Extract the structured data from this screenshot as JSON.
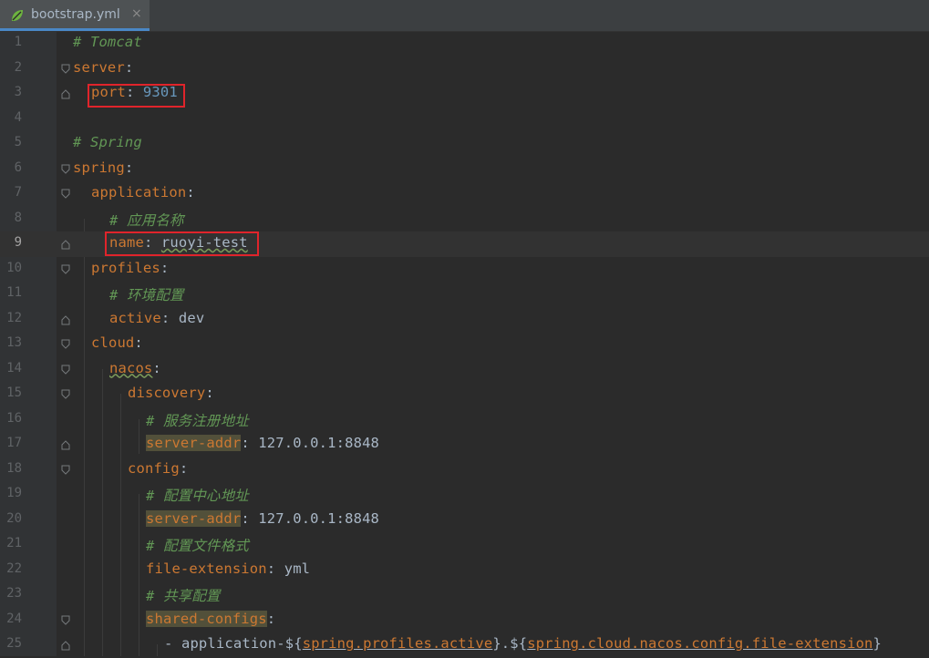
{
  "tab": {
    "label": "bootstrap.yml",
    "close": "×",
    "icon": "spring-leaf-icon"
  },
  "colors": {
    "keyword": "#cc7832",
    "comment": "#629755",
    "number": "#6897bb",
    "text": "#a9b7c6",
    "highlight_box": "#e0242b"
  },
  "lines": [
    {
      "num": "1",
      "indent": 0,
      "comment": "# Tomcat"
    },
    {
      "num": "2",
      "indent": 0,
      "key": "server",
      "sep": ":"
    },
    {
      "num": "3",
      "indent": 1,
      "key": "port",
      "sep": ": ",
      "number": "9301"
    },
    {
      "num": "4",
      "indent": 0
    },
    {
      "num": "5",
      "indent": 0,
      "comment": "# Spring"
    },
    {
      "num": "6",
      "indent": 0,
      "key": "spring",
      "sep": ":"
    },
    {
      "num": "7",
      "indent": 1,
      "key": "application",
      "sep": ":"
    },
    {
      "num": "8",
      "indent": 2,
      "comment": "# 应用名称"
    },
    {
      "num": "9",
      "indent": 2,
      "key": "name",
      "sep": ": ",
      "value": "ruoyi-test"
    },
    {
      "num": "10",
      "indent": 1,
      "key": "profiles",
      "sep": ":"
    },
    {
      "num": "11",
      "indent": 2,
      "comment": "# 环境配置"
    },
    {
      "num": "12",
      "indent": 2,
      "key": "active",
      "sep": ": ",
      "value": "dev"
    },
    {
      "num": "13",
      "indent": 1,
      "key": "cloud",
      "sep": ":"
    },
    {
      "num": "14",
      "indent": 2,
      "key": "nacos",
      "sep": ":"
    },
    {
      "num": "15",
      "indent": 3,
      "key": "discovery",
      "sep": ":"
    },
    {
      "num": "16",
      "indent": 4,
      "comment": "# 服务注册地址"
    },
    {
      "num": "17",
      "indent": 4,
      "key": "server-addr",
      "sep": ": ",
      "value": "127.0.0.1:8848"
    },
    {
      "num": "18",
      "indent": 3,
      "key": "config",
      "sep": ":"
    },
    {
      "num": "19",
      "indent": 4,
      "comment": "# 配置中心地址"
    },
    {
      "num": "20",
      "indent": 4,
      "key": "server-addr",
      "sep": ": ",
      "value": "127.0.0.1:8848"
    },
    {
      "num": "21",
      "indent": 4,
      "comment": "# 配置文件格式"
    },
    {
      "num": "22",
      "indent": 4,
      "key": "file-extension",
      "sep": ": ",
      "value": "yml"
    },
    {
      "num": "23",
      "indent": 4,
      "comment": "# 共享配置"
    },
    {
      "num": "24",
      "indent": 4,
      "key": "shared-configs",
      "sep": ":"
    },
    {
      "num": "25",
      "indent": 5,
      "seq": {
        "dash": "- ",
        "p1": "application-${",
        "ref1": "spring.profiles.active",
        "p2": "}.${",
        "ref2": "spring.cloud.nacos.config.file-extension",
        "p3": "}"
      }
    }
  ]
}
